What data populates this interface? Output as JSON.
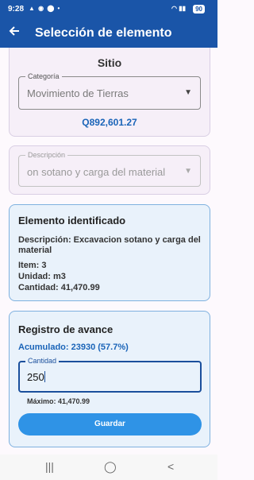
{
  "status_bar": {
    "time": "9:28",
    "left_icons": "▲ ◉ ⬤ •",
    "right_icons": "◠ ▮▮",
    "battery": "90"
  },
  "app_bar": {
    "back_icon": "arrow-left-icon",
    "title": "Selección de elemento"
  },
  "sitio_card": {
    "title": "Sitio",
    "categoria_label": "Categoría",
    "categoria_value": "Movimiento de Tierras",
    "price": "Q892,601.27"
  },
  "descripcion_card": {
    "label": "Descripción",
    "value": "on sotano y carga del material"
  },
  "elemento_card": {
    "title": "Elemento identificado",
    "descripcion": "Descripción: Excavacion sotano y carga del material",
    "item": "Item: 3",
    "unidad": "Unidad: m3",
    "cantidad": "Cantidad: 41,470.99"
  },
  "avance_card": {
    "title": "Registro de avance",
    "acumulado": "Acumulado: 23930 (57.7%)",
    "cantidad_label": "Cantidad",
    "cantidad_value": "250",
    "maximo": "Máximo: 41,470.99",
    "guardar_label": "Guardar"
  },
  "nav_bar": {
    "recents": "|||",
    "home": "◯",
    "back": "<"
  },
  "colors": {
    "primary": "#1a55a8",
    "accent": "#2f93e6",
    "link": "#1a64b8"
  }
}
